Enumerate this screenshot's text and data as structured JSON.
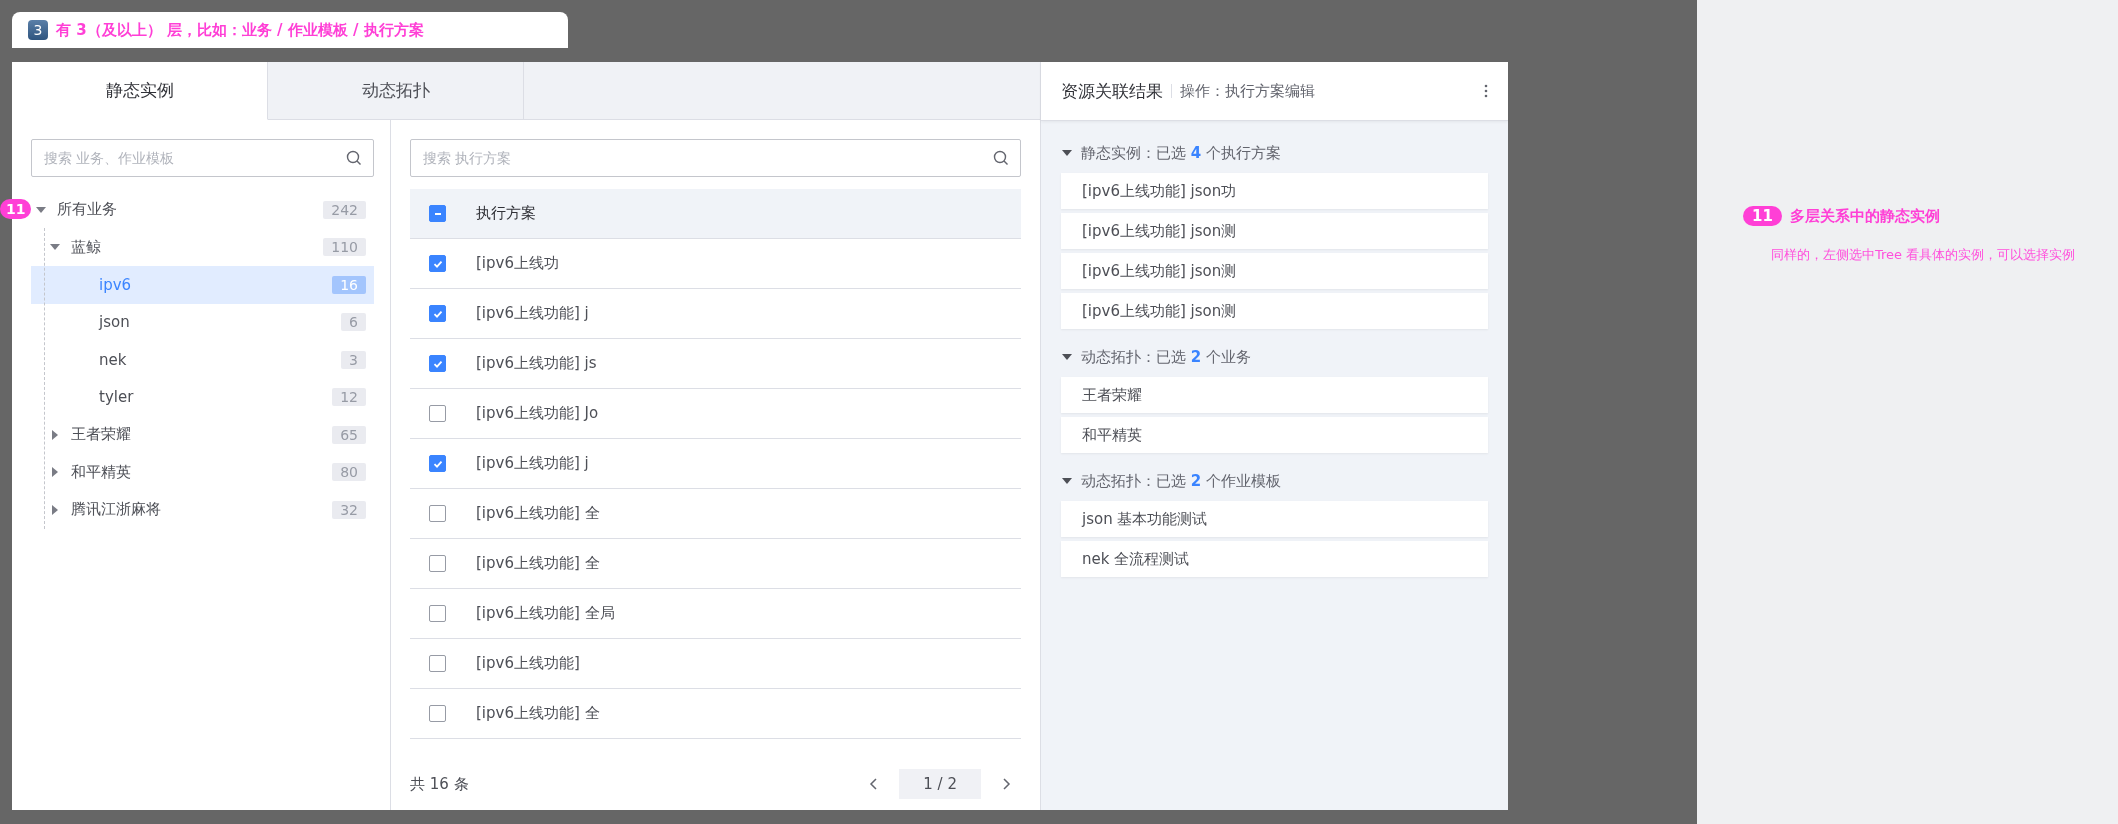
{
  "header_note": {
    "badge": "3",
    "text": "有 3（及以上） 层，比如：业务 / 作业模板 / 执行方案"
  },
  "tabs": [
    {
      "label": "静态实例",
      "selected": true
    },
    {
      "label": "动态拓扑",
      "selected": false
    }
  ],
  "tree_panel": {
    "search": {
      "placeholder": "搜索 业务、作业模板"
    },
    "marker": "11",
    "tree": [
      {
        "label": "所有业务",
        "count": "242",
        "expanded": true,
        "selected": false,
        "children": [
          {
            "label": "蓝鲸",
            "count": "110",
            "expanded": true,
            "selected": false,
            "children": [
              {
                "label": "ipv6",
                "count": "16",
                "selected": true
              },
              {
                "label": "json",
                "count": "6",
                "selected": false
              },
              {
                "label": "nek",
                "count": "3",
                "selected": false
              },
              {
                "label": "tyler",
                "count": "12",
                "selected": false
              }
            ]
          },
          {
            "label": "王者荣耀",
            "count": "65",
            "expanded": false,
            "selected": false
          },
          {
            "label": "和平精英",
            "count": "80",
            "expanded": false,
            "selected": false
          },
          {
            "label": "腾讯江浙麻将",
            "count": "32",
            "expanded": false,
            "selected": false
          }
        ]
      }
    ]
  },
  "plan_table": {
    "search": {
      "placeholder": "搜索 执行方案"
    },
    "header": {
      "label": "执行方案",
      "indeterminate": true
    },
    "rows": [
      {
        "text": "[ipv6上线功",
        "checked": true
      },
      {
        "text": "[ipv6上线功能] j",
        "checked": true
      },
      {
        "text": "[ipv6上线功能] js",
        "checked": true
      },
      {
        "text": "[ipv6上线功能] Jo",
        "checked": false
      },
      {
        "text": "[ipv6上线功能] j",
        "checked": true
      },
      {
        "text": "[ipv6上线功能] 全",
        "checked": false
      },
      {
        "text": "[ipv6上线功能] 全",
        "checked": false
      },
      {
        "text": "[ipv6上线功能] 全局",
        "checked": false
      },
      {
        "text": "[ipv6上线功能]",
        "checked": false
      },
      {
        "text": "[ipv6上线功能] 全",
        "checked": false
      }
    ],
    "total": "共 16 条",
    "page": "1 / 2"
  },
  "result_panel": {
    "title": "资源关联结果",
    "operation": "操作：执行方案编辑",
    "sections": [
      {
        "prefix": "静态实例：已选",
        "count": "4",
        "suffix": "个执行方案",
        "expanded": true,
        "items": [
          "[ipv6上线功能] json功",
          "[ipv6上线功能] json测",
          "[ipv6上线功能] json测",
          "[ipv6上线功能] json测"
        ]
      },
      {
        "prefix": "动态拓扑：已选",
        "count": "2",
        "suffix": "个业务",
        "expanded": true,
        "items": [
          "王者荣耀",
          "和平精英"
        ]
      },
      {
        "prefix": "动态拓扑：已选",
        "count": "2",
        "suffix": "个作业模板",
        "expanded": true,
        "items": [
          "json 基本功能测试",
          "nek 全流程测试"
        ]
      }
    ]
  },
  "annotation": {
    "badge": "11",
    "title": "多层关系中的静态实例",
    "description": "同样的，左侧选中Tree 看具体的实例，可以选择实例"
  }
}
